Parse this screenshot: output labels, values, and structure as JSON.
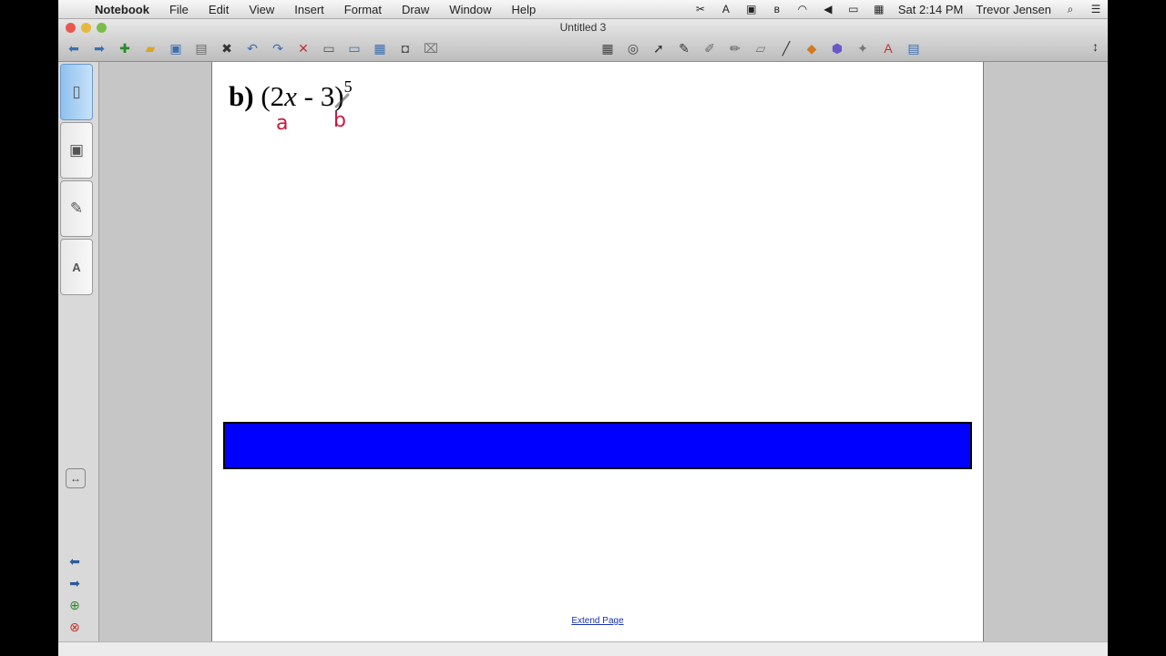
{
  "menubar": {
    "app_name": "Notebook",
    "menus": [
      "File",
      "Edit",
      "View",
      "Insert",
      "Format",
      "Draw",
      "Window",
      "Help"
    ],
    "clock": "Sat 2:14 PM",
    "user": "Trevor Jensen"
  },
  "window": {
    "title": "Untitled 3"
  },
  "page": {
    "problem_label": "b)",
    "expr_open": "(2",
    "expr_var": "x",
    "expr_mid": " - ",
    "expr_term": "3",
    "expr_close": ")",
    "exponent": "5",
    "annotation_a": "a",
    "annotation_b": "b",
    "extend_link": "Extend Page"
  },
  "colors": {
    "bar": "#0000ff",
    "annotation": "#c8193c"
  }
}
